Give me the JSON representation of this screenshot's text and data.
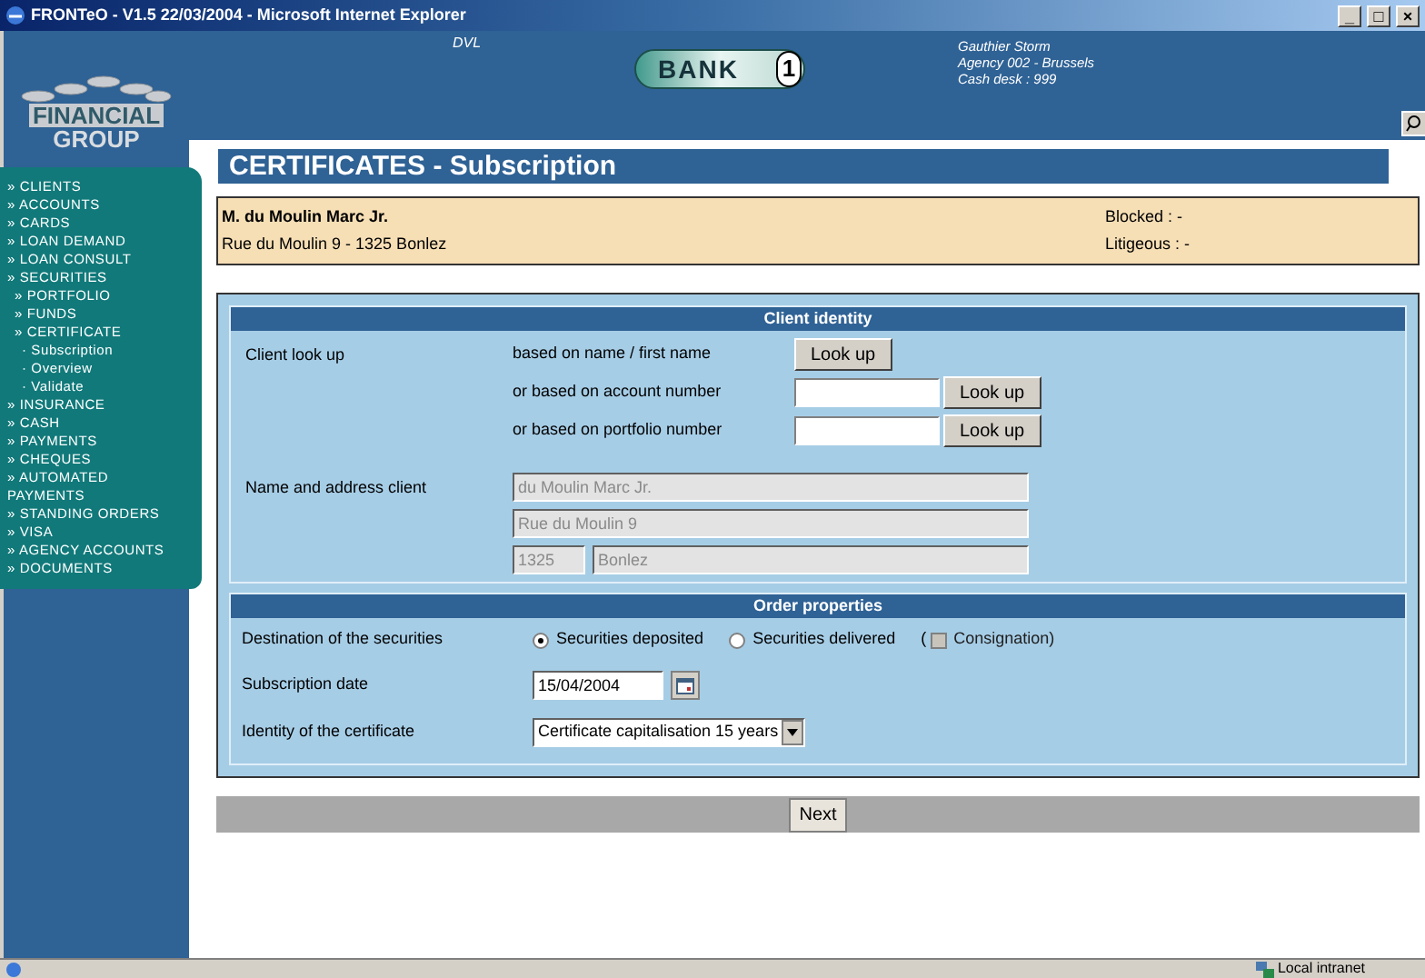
{
  "window": {
    "title": "FRONTeO - V1.5 22/03/2004 - Microsoft Internet Explorer",
    "controls": [
      "_",
      "□",
      "×"
    ]
  },
  "header": {
    "logo_lines": [
      "FINANCIAL",
      "GROUP"
    ],
    "env": "DVL",
    "bank_logo": {
      "text": "BANK",
      "number": "1"
    },
    "user": [
      "Gauthier Storm",
      "Agency 002 - Brussels",
      "Cash desk : 999"
    ]
  },
  "page_title": "CERTIFICATES - Subscription",
  "sidebar": {
    "items": [
      {
        "label": "» CLIENTS"
      },
      {
        "label": "» ACCOUNTS"
      },
      {
        "label": "» CARDS"
      },
      {
        "label": "» LOAN DEMAND"
      },
      {
        "label": "» LOAN CONSULT"
      },
      {
        "label": "» SECURITIES",
        "children": [
          {
            "label": "» PORTFOLIO"
          },
          {
            "label": "» FUNDS"
          },
          {
            "label": "» CERTIFICATE",
            "children": [
              {
                "label": "· Subscription"
              },
              {
                "label": "· Overview"
              },
              {
                "label": "· Validate"
              }
            ]
          }
        ]
      },
      {
        "label": "» INSURANCE"
      },
      {
        "label": "» CASH"
      },
      {
        "label": "» PAYMENTS"
      },
      {
        "label": "» CHEQUES"
      },
      {
        "label": "» AUTOMATED PAYMENTS"
      },
      {
        "label": "» STANDING ORDERS"
      },
      {
        "label": "» VISA"
      },
      {
        "label": "» AGENCY ACCOUNTS"
      },
      {
        "label": "» DOCUMENTS"
      }
    ]
  },
  "client": {
    "name": "M. du Moulin Marc Jr.",
    "address": "Rue du Moulin 9 - 1325 Bonlez",
    "blocked": "Blocked : -",
    "litigious": "Litigeous : -"
  },
  "client_identity": {
    "title": "Client identity",
    "lookup_label": "Client look up",
    "lookups": [
      {
        "label": "based on name / first name",
        "has_field": false,
        "button": "Look up"
      },
      {
        "label": "or based on account number",
        "has_field": true,
        "button": "Look up"
      },
      {
        "label": "or based on portfolio number",
        "has_field": true,
        "button": "Look up"
      }
    ],
    "address_label": "Name and address client",
    "name": "du Moulin Marc Jr.",
    "street": "Rue du Moulin 9",
    "zip": "1325",
    "city": "Bonlez"
  },
  "order": {
    "title": "Order properties",
    "destination_label": "Destination of the securities",
    "options": [
      {
        "label": "Securities deposited",
        "selected": true
      },
      {
        "label": "Securities delivered",
        "selected": false
      }
    ],
    "consignation": {
      "open": "(",
      "label": "Consignation)",
      "checked": false,
      "disabled": true
    },
    "date_label": "Subscription date",
    "date": "15/04/2004",
    "certificate_label": "Identity of the certificate",
    "certificate": "Certificate capitalisation 15 years"
  },
  "next_button": "Next",
  "status_bar": {
    "zone": "Local intranet"
  }
}
